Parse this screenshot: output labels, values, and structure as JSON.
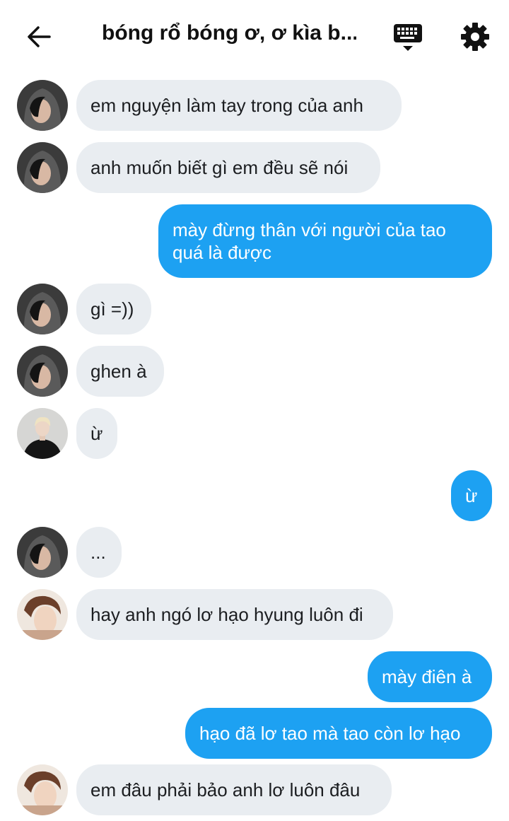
{
  "header": {
    "title": "bóng rổ bóng ơ, ơ kìa b...",
    "back_icon": "arrow-left-icon",
    "keyboard_icon": "keyboard-icon",
    "settings_icon": "gear-icon"
  },
  "colors": {
    "incoming_bubble": "#e9edf1",
    "outgoing_bubble": "#1da1f2",
    "text": "#1c1e21"
  },
  "messages": [
    {
      "side": "in",
      "avatar": "avatar-hooded",
      "text": "em nguyện làm tay trong của anh"
    },
    {
      "side": "in",
      "avatar": "avatar-hooded",
      "text": "anh muốn biết gì em đều sẽ nói"
    },
    {
      "side": "out",
      "text": "mày đừng thân với người của tao quá là được"
    },
    {
      "side": "in",
      "avatar": "avatar-hooded",
      "text": "gì =))"
    },
    {
      "side": "in",
      "avatar": "avatar-hooded",
      "text": "ghen à"
    },
    {
      "side": "in",
      "avatar": "avatar-blond",
      "text": "ừ"
    },
    {
      "side": "out",
      "text": "ừ"
    },
    {
      "side": "in",
      "avatar": "avatar-hooded",
      "text": "..."
    },
    {
      "side": "in",
      "avatar": "avatar-brown",
      "text": "hay anh ngó lơ hạo hyung luôn đi"
    },
    {
      "side": "out",
      "text": "mày điên à"
    },
    {
      "side": "out",
      "text": "hạo đã lơ tao mà tao còn lơ hạo"
    },
    {
      "side": "in",
      "avatar": "avatar-brown",
      "text": "em đâu phải bảo anh lơ luôn đâu"
    }
  ]
}
